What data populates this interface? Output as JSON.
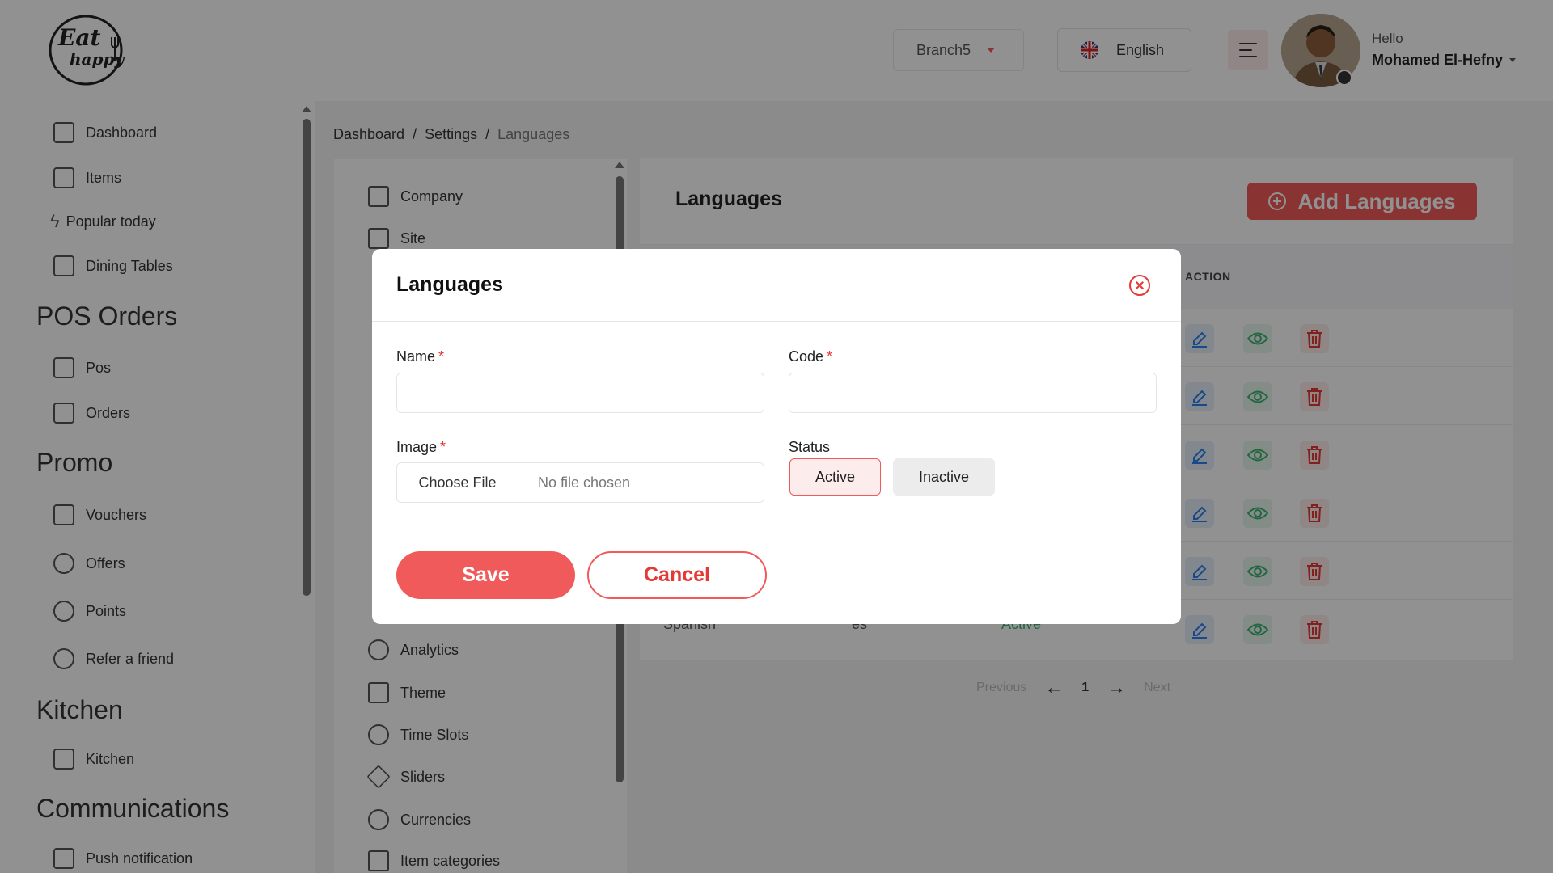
{
  "header": {
    "logo_text_top": "Eat",
    "logo_text_bottom": "happy",
    "branch": "Branch5",
    "language": "English",
    "greeting": "Hello",
    "username": "Mohamed El-Hefny"
  },
  "sidebar": {
    "items_top": [
      {
        "label": "Dashboard",
        "icon": "dashboard-icon"
      },
      {
        "label": "Items",
        "icon": "items-icon"
      },
      {
        "label": "Popular today",
        "icon": "lightning-icon"
      },
      {
        "label": "Dining Tables",
        "icon": "table-icon"
      }
    ],
    "section_pos": "POS Orders",
    "items_pos": [
      {
        "label": "Pos",
        "icon": "register-icon"
      },
      {
        "label": "Orders",
        "icon": "orders-icon"
      }
    ],
    "section_promo": "Promo",
    "items_promo": [
      {
        "label": "Vouchers",
        "icon": "voucher-icon"
      },
      {
        "label": "Offers",
        "icon": "gear-icon"
      },
      {
        "label": "Points",
        "icon": "coins-icon"
      },
      {
        "label": "Refer a friend",
        "icon": "users-icon"
      }
    ],
    "section_kitchen": "Kitchen",
    "items_kitchen": [
      {
        "label": "Kitchen",
        "icon": "kitchen-icon"
      }
    ],
    "section_comm": "Communications",
    "items_comm": [
      {
        "label": "Push notification",
        "icon": "bell-icon"
      }
    ]
  },
  "breadcrumb": {
    "home": "Dashboard",
    "sep": "/",
    "parent": "Settings",
    "current": "Languages"
  },
  "settings_menu": [
    {
      "label": "Company",
      "icon": "building-icon"
    },
    {
      "label": "Site",
      "icon": "link-icon"
    },
    {
      "label": "Analytics",
      "icon": "pie-chart-icon"
    },
    {
      "label": "Theme",
      "icon": "monitor-icon"
    },
    {
      "label": "Time Slots",
      "icon": "clock-icon"
    },
    {
      "label": "Sliders",
      "icon": "layers-icon"
    },
    {
      "label": "Currencies",
      "icon": "currency-icon"
    },
    {
      "label": "Item categories",
      "icon": "grid-icon"
    }
  ],
  "languages_card": {
    "title": "Languages",
    "add_button": "Add Languages",
    "action_header": "ACTION",
    "last_row": {
      "name": "Spanish",
      "code": "es",
      "status": "Active"
    }
  },
  "pagination": {
    "previous": "Previous",
    "page": "1",
    "next": "Next"
  },
  "modal": {
    "title": "Languages",
    "name_label": "Name",
    "code_label": "Code",
    "image_label": "Image",
    "required_mark": "*",
    "file_button": "Choose File",
    "file_status": "No file chosen",
    "status_label": "Status",
    "status_active": "Active",
    "status_inactive": "Inactive",
    "save": "Save",
    "cancel": "Cancel",
    "name_value": "",
    "code_value": ""
  },
  "colors": {
    "accent": "#f15a5a",
    "danger": "#e53935",
    "success": "#3cb371",
    "edit": "#2f80ed"
  }
}
